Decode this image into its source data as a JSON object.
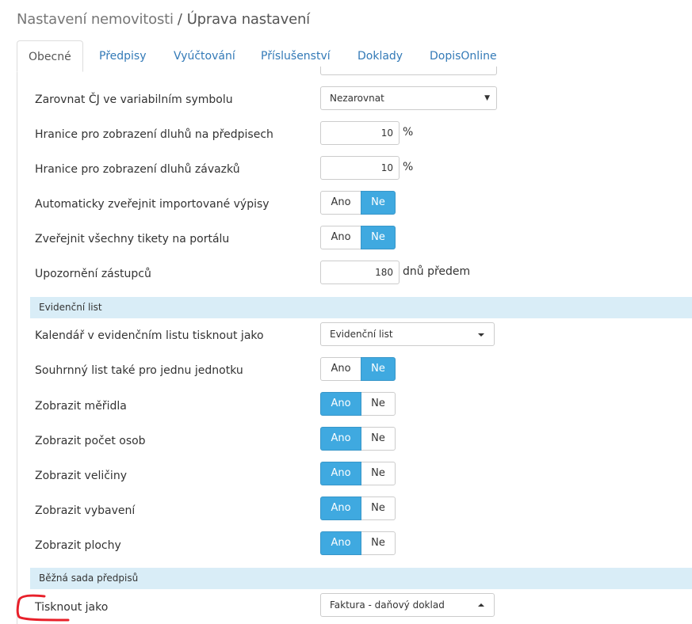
{
  "breadcrumb": {
    "parent": "Nastavení nemovitosti",
    "separator": "/",
    "current": "Úprava nastavení"
  },
  "tabs": [
    {
      "label": "Obecné",
      "active": true
    },
    {
      "label": "Předpisy",
      "active": false
    },
    {
      "label": "Vyúčtování",
      "active": false
    },
    {
      "label": "Příslušenství",
      "active": false
    },
    {
      "label": "Doklady",
      "active": false
    },
    {
      "label": "DopisOnline",
      "active": false
    }
  ],
  "settings": {
    "zarovnat": {
      "label": "Zarovnat ČJ ve variabilním symbolu",
      "value": "Nezarovnat"
    },
    "hranice_predpisy": {
      "label": "Hranice pro zobrazení dluhů na předpisech",
      "value": "10",
      "unit": "%"
    },
    "hranice_zavazky": {
      "label": "Hranice pro zobrazení dluhů závazků",
      "value": "10",
      "unit": "%"
    },
    "auto_zverejnit": {
      "label": "Automaticky zveřejnit importované výpisy",
      "ano": "Ano",
      "ne": "Ne",
      "selected": "Ne"
    },
    "zverejnit_tikety": {
      "label": "Zveřejnit všechny tikety na portálu",
      "ano": "Ano",
      "ne": "Ne",
      "selected": "Ne"
    },
    "upozorneni": {
      "label": "Upozornění zástupců",
      "value": "180",
      "unit": "dnů předem"
    }
  },
  "evidencni_list": {
    "heading": "Evidenční list",
    "kalendar": {
      "label": "Kalendář v evidenčním listu tisknout jako",
      "value": "Evidenční list"
    },
    "souhrnny": {
      "label": "Souhrnný list také pro jednu jednotku",
      "ano": "Ano",
      "ne": "Ne",
      "selected": "Ne"
    },
    "meridla": {
      "label": "Zobrazit měřidla",
      "ano": "Ano",
      "ne": "Ne",
      "selected": "Ano"
    },
    "pocet_osob": {
      "label": "Zobrazit počet osob",
      "ano": "Ano",
      "ne": "Ne",
      "selected": "Ano"
    },
    "veliciny": {
      "label": "Zobrazit veličiny",
      "ano": "Ano",
      "ne": "Ne",
      "selected": "Ano"
    },
    "vybaveni": {
      "label": "Zobrazit vybavení",
      "ano": "Ano",
      "ne": "Ne",
      "selected": "Ano"
    },
    "plochy": {
      "label": "Zobrazit plochy",
      "ano": "Ano",
      "ne": "Ne",
      "selected": "Ano"
    }
  },
  "bezna_sada": {
    "heading": "Běžná sada předpisů",
    "tisknout": {
      "label": "Tisknout jako",
      "value": "Faktura - daňový doklad"
    }
  },
  "colors": {
    "accent": "#3fa9e0",
    "section_bg": "#d9edf7",
    "link": "#337ab7",
    "annotation": "#e8202a"
  }
}
